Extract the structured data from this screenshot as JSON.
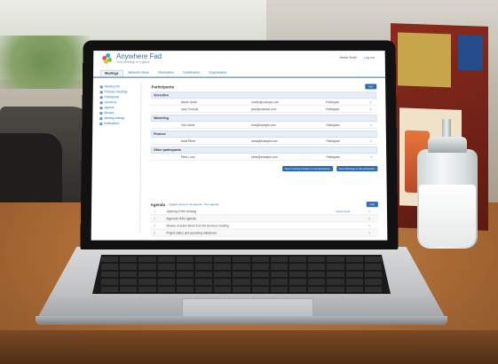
{
  "app": {
    "title": "Anywhere Fad",
    "tagline": "Your meeting, to a good",
    "user": "Martin Smith",
    "logout": "Log out"
  },
  "nav": {
    "tabs": [
      {
        "label": "Meetings",
        "active": true
      },
      {
        "label": "Network Views",
        "active": false
      },
      {
        "label": "Information",
        "active": false
      },
      {
        "label": "Contributors",
        "active": false
      },
      {
        "label": "Organization",
        "active": false
      }
    ]
  },
  "sidebar": {
    "items": [
      {
        "label": "Meeting info"
      },
      {
        "label": "Previous meetings"
      },
      {
        "label": "Participants"
      },
      {
        "label": "Decisions"
      },
      {
        "label": "Agenda"
      },
      {
        "label": "Minutes"
      },
      {
        "label": "Meeting settings"
      },
      {
        "label": "Notifications"
      }
    ]
  },
  "participants": {
    "title": "Participants",
    "add_label": "Add",
    "sections": [
      {
        "title": "Executive",
        "rows": [
          {
            "name": "Martin Smith",
            "role": "",
            "email": "martin@example.com",
            "status": "Participant"
          },
          {
            "name": "Jane Thomas",
            "role": "",
            "email": "jane@example.com",
            "status": "Participant"
          }
        ]
      },
      {
        "title": "Marketing",
        "rows": [
          {
            "name": "Tom Harris",
            "role": "",
            "email": "tom@example.com",
            "status": "Participant"
          }
        ]
      },
      {
        "title": "Finance",
        "rows": [
          {
            "name": "Anna Reed",
            "role": "",
            "email": "anna@example.com",
            "status": "Participant"
          }
        ]
      },
      {
        "title": "Other participants",
        "rows": [
          {
            "name": "Peter Lund",
            "role": "",
            "email": "peter@example.com",
            "status": "Participant"
          }
        ]
      }
    ],
    "buttons": [
      "Send meeting invitation to all participants",
      "Send Message to all participants"
    ]
  },
  "agenda": {
    "title": "Agenda",
    "links": "Suggest points for the agenda  ·  Print agenda",
    "add_label": "Add",
    "rows": [
      {
        "num": "1",
        "text": "Opening of the meeting",
        "meta": "Martin Smith"
      },
      {
        "num": "2",
        "text": "Approval of the agenda",
        "meta": ""
      },
      {
        "num": "3",
        "text": "Review of action items from the previous meeting",
        "meta": ""
      },
      {
        "num": "4",
        "text": "Project status and upcoming milestones",
        "meta": ""
      }
    ]
  },
  "colors": {
    "accent": "#2b6cb0"
  }
}
